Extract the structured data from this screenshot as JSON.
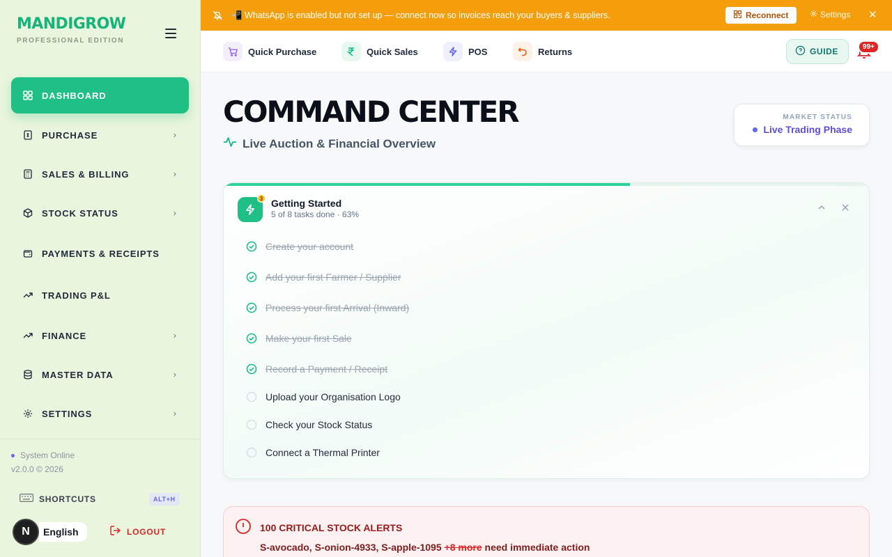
{
  "sidebar": {
    "brand": "MANDIGROW",
    "edition": "PROFESSIONAL EDITION",
    "items": [
      {
        "label": "DASHBOARD",
        "active": true
      },
      {
        "label": "PURCHASE"
      },
      {
        "label": "SALES & BILLING"
      },
      {
        "label": "STOCK STATUS"
      },
      {
        "label": "PAYMENTS & RECEIPTS"
      },
      {
        "label": "TRADING P&L"
      },
      {
        "label": "FINANCE"
      },
      {
        "label": "MASTER DATA"
      },
      {
        "label": "SETTINGS"
      }
    ],
    "system_status": "System Online",
    "version": "v2.0.0 © 2026",
    "shortcuts_label": "SHORTCUTS",
    "shortcuts_key": "ALT+H",
    "language": "English",
    "language_initial": "N",
    "logout_label": "LOGOUT"
  },
  "banner": {
    "message": "📲 WhatsApp is enabled but not set up — connect now so invoices reach your buyers & suppliers.",
    "reconnect_label": "Reconnect",
    "settings_label": "Settings",
    "close_glyph": "✕"
  },
  "quick_actions": [
    {
      "label": "Quick Purchase"
    },
    {
      "label": "Quick Sales"
    },
    {
      "label": "POS"
    },
    {
      "label": "Returns"
    }
  ],
  "header": {
    "guide_label": "GUIDE",
    "notification_count": "99+",
    "title": "COMMAND CENTER",
    "subtitle": "Live Auction & Financial Overview",
    "market_label": "MARKET STATUS",
    "market_value": "Live Trading Phase"
  },
  "getting_started": {
    "title": "Getting Started",
    "subtitle": "5 of 8 tasks done · 63%",
    "badge": "3",
    "progress": 0.63,
    "tasks": [
      {
        "label": "Create your account",
        "done": true
      },
      {
        "label": "Add your first Farmer / Supplier",
        "done": true
      },
      {
        "label": "Process your first Arrival (Inward)",
        "done": true
      },
      {
        "label": "Make your first Sale",
        "done": true
      },
      {
        "label": "Record a Payment / Receipt",
        "done": true
      },
      {
        "label": "Upload your Organisation Logo",
        "done": false
      },
      {
        "label": "Check your Stock Status",
        "done": false
      },
      {
        "label": "Connect a Thermal Printer",
        "done": false
      }
    ]
  },
  "alert": {
    "title": "100 CRITICAL STOCK ALERTS",
    "items_text": "S-avocado, S-onion-4933, S-apple-1095",
    "more_text": "+8 more",
    "suffix_text": "need immediate action"
  },
  "colors": {
    "accent": "#1fbf85",
    "banner": "#f59e0b",
    "danger": "#dc2626",
    "indigo": "#6366f1"
  }
}
